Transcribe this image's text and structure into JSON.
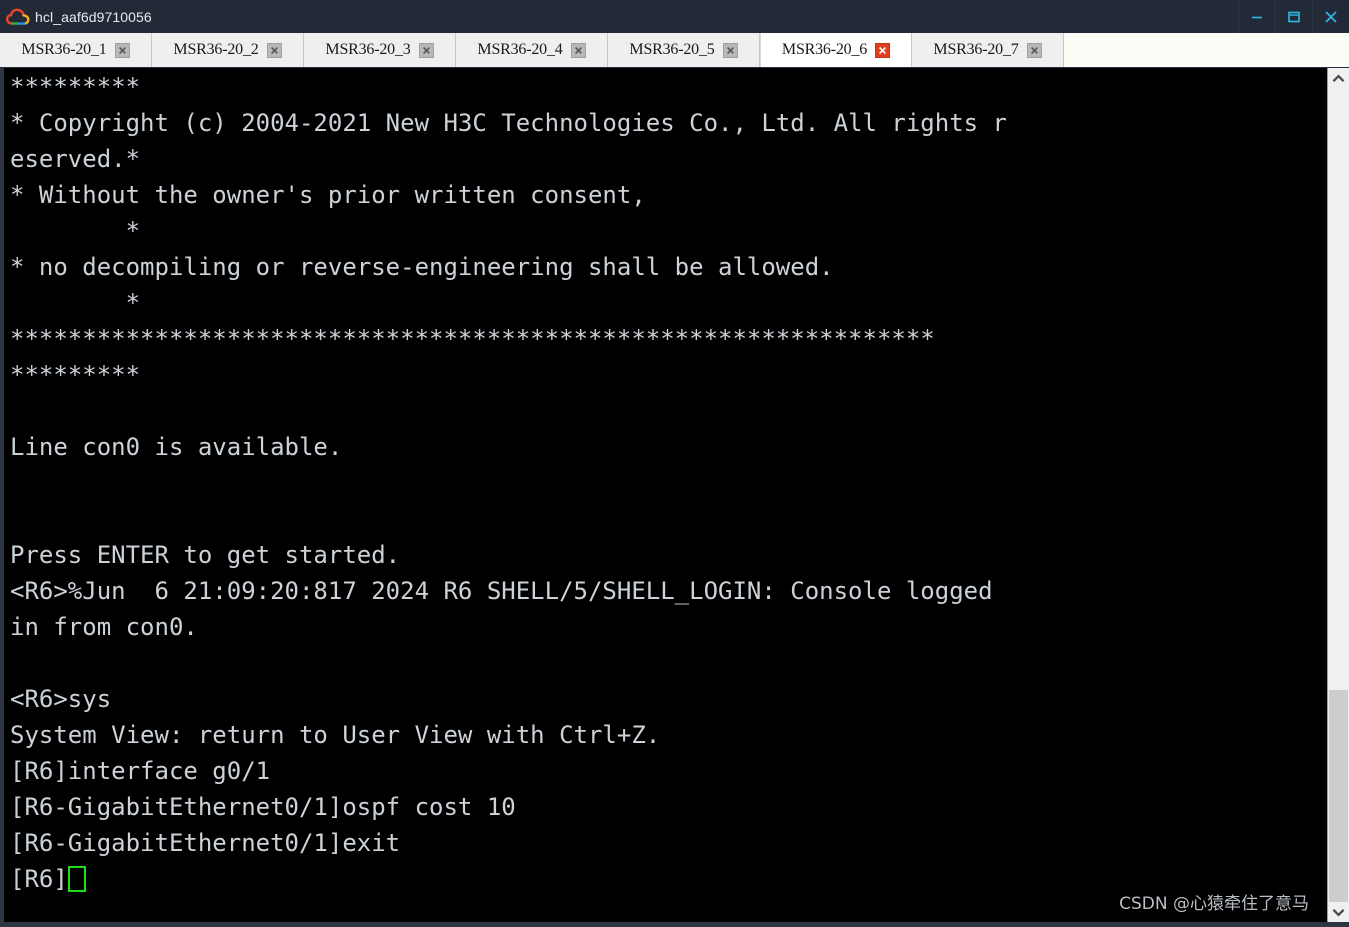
{
  "window": {
    "title": "hcl_aaf6d9710056",
    "logo_icon": "cloud-icon",
    "controls": [
      {
        "name": "minimize-button",
        "icon": "minimize-icon"
      },
      {
        "name": "maximize-button",
        "icon": "maximize-icon"
      },
      {
        "name": "close-button",
        "icon": "close-icon"
      }
    ]
  },
  "tabs": [
    {
      "label": "MSR36-20_1",
      "active": false,
      "close_icon": "close-icon"
    },
    {
      "label": "MSR36-20_2",
      "active": false,
      "close_icon": "close-icon"
    },
    {
      "label": "MSR36-20_3",
      "active": false,
      "close_icon": "close-icon"
    },
    {
      "label": "MSR36-20_4",
      "active": false,
      "close_icon": "close-icon"
    },
    {
      "label": "MSR36-20_5",
      "active": false,
      "close_icon": "close-icon"
    },
    {
      "label": "MSR36-20_6",
      "active": true,
      "close_icon": "close-icon"
    },
    {
      "label": "MSR36-20_7",
      "active": false,
      "close_icon": "close-icon"
    }
  ],
  "terminal": {
    "lines": [
      "*********",
      "* Copyright (c) 2004-2021 New H3C Technologies Co., Ltd. All rights r",
      "eserved.*",
      "* Without the owner's prior written consent,",
      "        *",
      "* no decompiling or reverse-engineering shall be allowed.",
      "        *",
      "****************************************************************",
      "*********",
      "",
      "Line con0 is available.",
      "",
      "",
      "Press ENTER to get started.",
      "<R6>%Jun  6 21:09:20:817 2024 R6 SHELL/5/SHELL_LOGIN: Console logged",
      "in from con0.",
      "",
      "<R6>sys",
      "System View: return to User View with Ctrl+Z.",
      "[R6]interface g0/1",
      "[R6-GigabitEthernet0/1]ospf cost 10",
      "[R6-GigabitEthernet0/1]exit"
    ],
    "prompt": "[R6]",
    "cursor": "block-cursor",
    "cursor_color": "#19e019",
    "text_color": "#ccd2d8",
    "background_color": "#000000"
  },
  "watermark": {
    "text": "CSDN @心猿牵住了意马"
  },
  "scrollbar": {
    "up_icon": "chevron-up-icon",
    "down_icon": "chevron-down-icon",
    "thumb_top_pct": 74,
    "thumb_height_pct": 26
  }
}
